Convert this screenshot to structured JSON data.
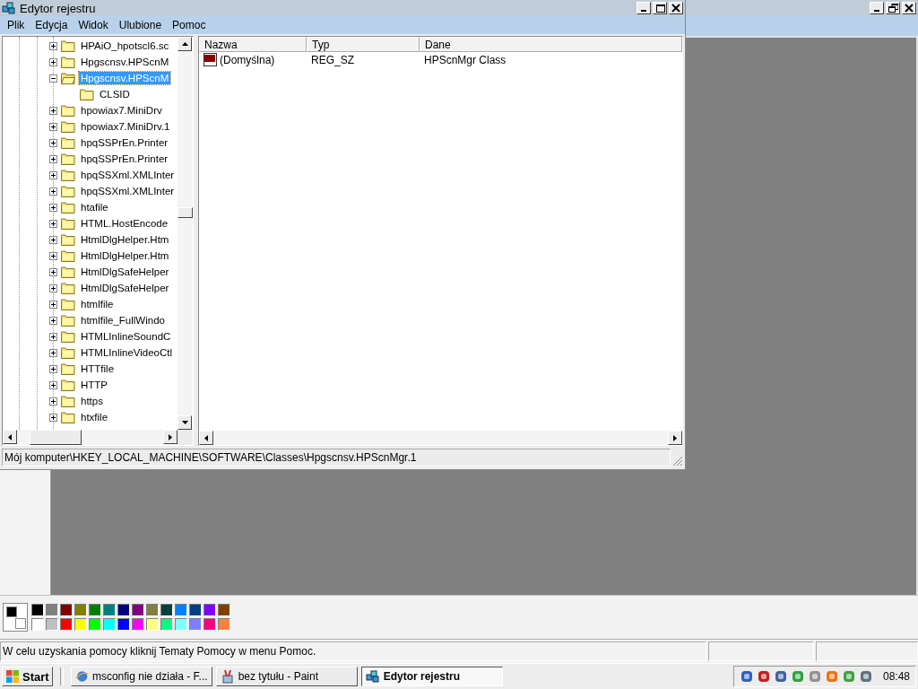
{
  "paint": {
    "palette": {
      "colors": [
        {
          "color": "#000000"
        },
        {
          "color": "#808080"
        },
        {
          "color": "#800000"
        },
        {
          "color": "#808000"
        },
        {
          "color": "#008000"
        },
        {
          "color": "#008080"
        },
        {
          "color": "#000080"
        },
        {
          "color": "#800080"
        },
        {
          "color": "#808040"
        },
        {
          "color": "#004040"
        },
        {
          "color": "#0080ff"
        },
        {
          "color": "#004080"
        },
        {
          "color": "#8000ff"
        },
        {
          "color": "#804000"
        },
        {
          "color": "#ffffff"
        },
        {
          "color": "#c0c0c0"
        },
        {
          "color": "#ff0000"
        },
        {
          "color": "#ffff00"
        },
        {
          "color": "#00ff00"
        },
        {
          "color": "#00ffff"
        },
        {
          "color": "#0000ff"
        },
        {
          "color": "#ff00ff"
        },
        {
          "color": "#ffff80"
        },
        {
          "color": "#00ff80"
        },
        {
          "color": "#80ffff"
        },
        {
          "color": "#8080ff"
        },
        {
          "color": "#ff0080"
        },
        {
          "color": "#ff8040"
        }
      ]
    },
    "status_bar": "W celu uzyskania pomocy kliknij Tematy Pomocy w menu Pomoc."
  },
  "regedit": {
    "title": "Edytor rejestru",
    "menu": [
      "Plik",
      "Edycja",
      "Widok",
      "Ulubione",
      "Pomoc"
    ],
    "tree": [
      {
        "label": "HPAiO_hpotscl6.sc",
        "expanded": false,
        "selected": false
      },
      {
        "label": "Hpgscnsv.HPScnM",
        "expanded": false,
        "selected": false
      },
      {
        "label": "Hpgscnsv.HPScnM",
        "expanded": true,
        "selected": true,
        "children": [
          {
            "label": "CLSID",
            "selected": false
          }
        ]
      },
      {
        "label": "hpowiax7.MiniDrv",
        "expanded": false,
        "selected": false
      },
      {
        "label": "hpowiax7.MiniDrv.1",
        "expanded": false,
        "selected": false
      },
      {
        "label": "hpqSSPrEn.Printer",
        "expanded": false,
        "selected": false
      },
      {
        "label": "hpqSSPrEn.Printer",
        "expanded": false,
        "selected": false
      },
      {
        "label": "hpqSSXml.XMLInter",
        "expanded": false,
        "selected": false
      },
      {
        "label": "hpqSSXml.XMLInter",
        "expanded": false,
        "selected": false
      },
      {
        "label": "htafile",
        "expanded": false,
        "selected": false
      },
      {
        "label": "HTML.HostEncode",
        "expanded": false,
        "selected": false
      },
      {
        "label": "HtmlDlgHelper.Htm",
        "expanded": false,
        "selected": false
      },
      {
        "label": "HtmlDlgHelper.Htm",
        "expanded": false,
        "selected": false
      },
      {
        "label": "HtmlDlgSafeHelper",
        "expanded": false,
        "selected": false
      },
      {
        "label": "HtmlDlgSafeHelper",
        "expanded": false,
        "selected": false
      },
      {
        "label": "htmlfile",
        "expanded": false,
        "selected": false
      },
      {
        "label": "htmlfile_FullWindo",
        "expanded": false,
        "selected": false
      },
      {
        "label": "HTMLInlineSoundC",
        "expanded": false,
        "selected": false
      },
      {
        "label": "HTMLInlineVideoCtl",
        "expanded": false,
        "selected": false
      },
      {
        "label": "HTTfile",
        "expanded": false,
        "selected": false
      },
      {
        "label": "HTTP",
        "expanded": false,
        "selected": false
      },
      {
        "label": "https",
        "expanded": false,
        "selected": false
      },
      {
        "label": "htxfile",
        "expanded": false,
        "selected": false
      }
    ],
    "table": {
      "columns": [
        "Nazwa",
        "Typ",
        "Dane"
      ],
      "rows": [
        {
          "name": "(Domyślna)",
          "type": "REG_SZ",
          "data": "HPScnMgr Class"
        }
      ]
    },
    "status_bar": "Mój komputer\\HKEY_LOCAL_MACHINE\\SOFTWARE\\Classes\\Hpgscnsv.HPScnMgr.1"
  },
  "taskbar": {
    "start": "Start",
    "buttons": [
      {
        "label": "msconfig nie działa - F...",
        "kind": "browser",
        "selected": false
      },
      {
        "label": "bez tytułu - Paint",
        "kind": "paint",
        "selected": false
      },
      {
        "label": "Edytor rejestru",
        "kind": "registry",
        "selected": true
      }
    ],
    "clock": "08:48"
  }
}
